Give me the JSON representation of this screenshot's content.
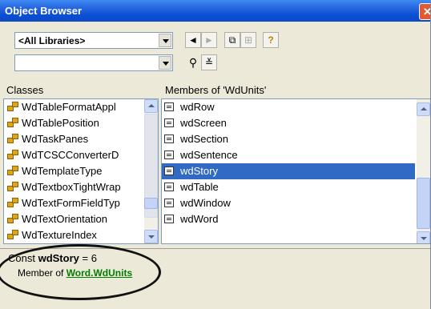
{
  "window": {
    "title": "Object Browser",
    "close_glyph": "✕"
  },
  "toolbar": {
    "library_value": "<All Libraries>",
    "search_value": "",
    "back_glyph": "◄",
    "forward_glyph": "►",
    "copy_glyph": "⧉",
    "view_def_glyph": "⊞",
    "help_glyph": "?",
    "search_glyph": "⚲",
    "toggle_glyph": "≚"
  },
  "classes": {
    "header": "Classes",
    "items": [
      "WdTableFormatAppl",
      "WdTablePosition",
      "WdTaskPanes",
      "WdTCSCConverterD",
      "WdTemplateType",
      "WdTextboxTightWrap",
      "WdTextFormFieldTyp",
      "WdTextOrientation",
      "WdTextureIndex"
    ]
  },
  "members": {
    "header": "Members of 'WdUnits'",
    "items": [
      "wdRow",
      "wdScreen",
      "wdSection",
      "wdSentence",
      "wdStory",
      "wdTable",
      "wdWindow",
      "wdWord"
    ],
    "selected_index": 4
  },
  "details": {
    "prefix": "Const ",
    "name": "wdStory",
    "suffix": " = 6",
    "member_of_label": "Member of ",
    "library_link": "Word",
    "separator": ".",
    "class_link": "WdUnits"
  },
  "colors": {
    "title_bar": "#0a4fd4",
    "selection": "#316AC5",
    "link": "#008000",
    "panel": "#ECE9D8"
  },
  "icons": {
    "class": "class-module-icon",
    "member": "enum-constant-icon"
  }
}
